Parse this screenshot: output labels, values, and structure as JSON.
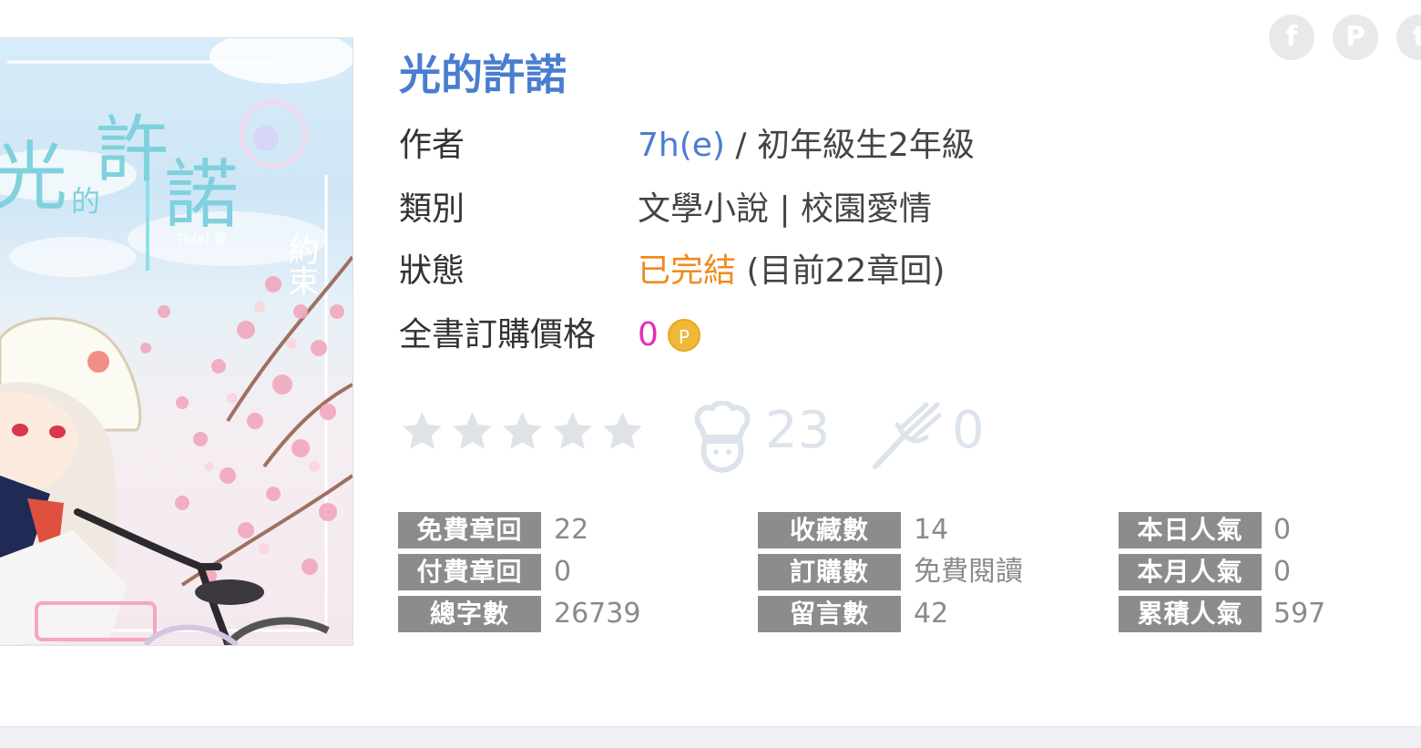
{
  "book": {
    "title": "光的許諾",
    "cover": {
      "title_chars": [
        "光",
        "的",
        "許",
        "諾"
      ],
      "vertical_text": "約束",
      "author_tag": "7h(e)  著"
    },
    "author_label": "作者",
    "author_name": "7h(e)",
    "author_separator": " / ",
    "author_rank": "初年級生2年級",
    "category_label": "類別",
    "category_value": "文學小說 | 校園愛情",
    "status_label": "狀態",
    "status_value": "已完結",
    "status_detail": " (目前22章回)",
    "price_label": "全書訂購價格",
    "price_value": "0",
    "coin_symbol": "P"
  },
  "rating": {
    "stars_filled": 0,
    "stars_total": 5
  },
  "reactions": {
    "chef_count": "23",
    "fork_count": "0"
  },
  "share": {
    "facebook": "f",
    "pinterest": "P",
    "twitter": "t"
  },
  "stats": {
    "free_chapters": {
      "label": "免費章回",
      "value": "22"
    },
    "paid_chapters": {
      "label": "付費章回",
      "value": "0"
    },
    "word_count": {
      "label": "總字數",
      "value": "26739"
    },
    "favorites": {
      "label": "收藏數",
      "value": "14"
    },
    "subscriptions": {
      "label": "訂購數",
      "value": "免費閱讀"
    },
    "comments": {
      "label": "留言數",
      "value": "42"
    },
    "daily_popularity": {
      "label": "本日人氣",
      "value": "0"
    },
    "monthly_popularity": {
      "label": "本月人氣",
      "value": "0"
    },
    "total_popularity": {
      "label": "累積人氣",
      "value": "597"
    }
  },
  "colors": {
    "link": "#4a7dd0",
    "status_complete": "#f08a1c",
    "price": "#e32fb5",
    "stat_label_bg": "#8c8c8c",
    "muted_icon": "#dde3ea"
  }
}
